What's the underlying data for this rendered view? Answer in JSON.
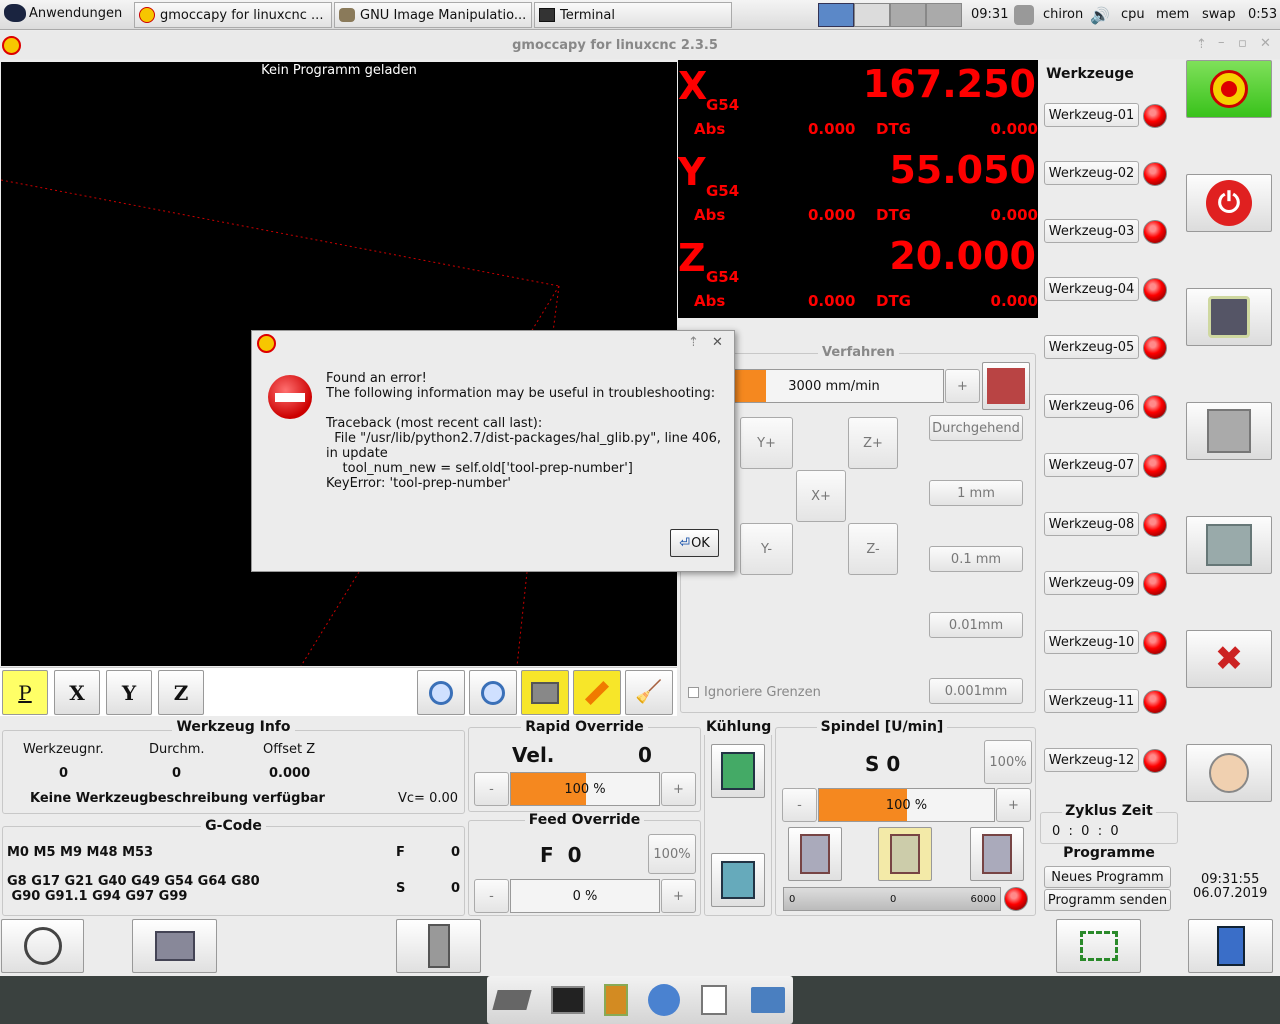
{
  "toppanel": {
    "apps_label": "Anwendungen",
    "tasks": [
      "gmoccapy for linuxcnc ...",
      "GNU Image Manipulatio...",
      "Terminal"
    ],
    "clock": "09:31",
    "host": "chiron",
    "monitors": [
      "cpu",
      "mem",
      "swap"
    ],
    "uptime": "0:53"
  },
  "window": {
    "title": "gmoccapy for linuxcnc  2.3.5"
  },
  "viewer": {
    "status": "Kein Programm geladen"
  },
  "dro": [
    {
      "axis": "X",
      "cs": "G54",
      "value": "167.250",
      "abs_label": "Abs",
      "abs_value": "0.000",
      "dtg_label": "DTG",
      "dtg_value": "0.000"
    },
    {
      "axis": "Y",
      "cs": "G54",
      "value": "55.050",
      "abs_label": "Abs",
      "abs_value": "0.000",
      "dtg_label": "DTG",
      "dtg_value": "0.000"
    },
    {
      "axis": "Z",
      "cs": "G54",
      "value": "20.000",
      "abs_label": "Abs",
      "abs_value": "0.000",
      "dtg_label": "DTG",
      "dtg_value": "0.000"
    }
  ],
  "jog": {
    "title": "Verfahren",
    "speed": "3000 mm/min",
    "plus": "+",
    "yplus": "Y+",
    "zplus": "Z+",
    "xplus": "X+",
    "yminus": "Y-",
    "zminus": "Z-",
    "increments": [
      "Durchgehend",
      "1 mm",
      "0.1 mm",
      "0.01mm",
      "0.001mm"
    ],
    "ignore_limits": "Ignoriere Grenzen"
  },
  "tools": {
    "title": "Werkzeuge",
    "items": [
      "Werkzeug-01",
      "Werkzeug-02",
      "Werkzeug-03",
      "Werkzeug-04",
      "Werkzeug-05",
      "Werkzeug-06",
      "Werkzeug-07",
      "Werkzeug-08",
      "Werkzeug-09",
      "Werkzeug-10",
      "Werkzeug-11",
      "Werkzeug-12"
    ]
  },
  "toolinfo": {
    "title": "Werkzeug Info",
    "col1": "Werkzeugnr.",
    "col2": "Durchm.",
    "col3": "Offset Z",
    "v1": "0",
    "v2": "0",
    "v3": "0.000",
    "desc": "Keine Werkzeugbeschreibung verfügbar",
    "vc": "Vc= 0.00"
  },
  "gcode": {
    "title": "G-Code",
    "line1": "M0 M5 M9 M48 M53",
    "line2": "G8 G17 G21 G40 G49 G54 G64 G80",
    "line3": " G90 G91.1 G94 G97 G99",
    "f_label": "F",
    "f_value": "0",
    "s_label": "S",
    "s_value": "0"
  },
  "rapid": {
    "title": "Rapid Override",
    "vel_label": "Vel.",
    "vel_value": "0",
    "percent": "100 %",
    "minus": "-",
    "plus": "+"
  },
  "feed": {
    "title": "Feed Override",
    "label": "F  0",
    "percent": "0 %",
    "reset": "100%",
    "minus": "-",
    "plus": "+"
  },
  "cool": {
    "title": "Kühlung"
  },
  "spindle": {
    "title": "Spindel [U/min]",
    "label": "S 0",
    "reset": "100%",
    "percent": "100 %",
    "minus": "-",
    "plus": "+",
    "bar_min": "0",
    "bar_val": "0",
    "bar_max": "6000"
  },
  "cycle": {
    "title": "Zyklus Zeit",
    "value": "0  :  0  :  0"
  },
  "programs": {
    "title": "Programme",
    "new": "Neues Programm",
    "send": "Programm senden"
  },
  "datetime": {
    "time": "09:31:55",
    "date": "06.07.2019"
  },
  "dialog": {
    "line1": "Found an error!",
    "line2": "The following information may be useful in troubleshooting:",
    "tb1": "Traceback (most recent call last):",
    "tb2": "  File \"/usr/lib/python2.7/dist-packages/hal_glib.py\", line 406,",
    "tb3": "in update",
    "tb4": "    tool_num_new = self.old['tool-prep-number']",
    "tb5": "KeyError: 'tool-prep-number'",
    "ok": "OK"
  },
  "view_buttons": [
    "P",
    "X",
    "Y",
    "Z"
  ]
}
